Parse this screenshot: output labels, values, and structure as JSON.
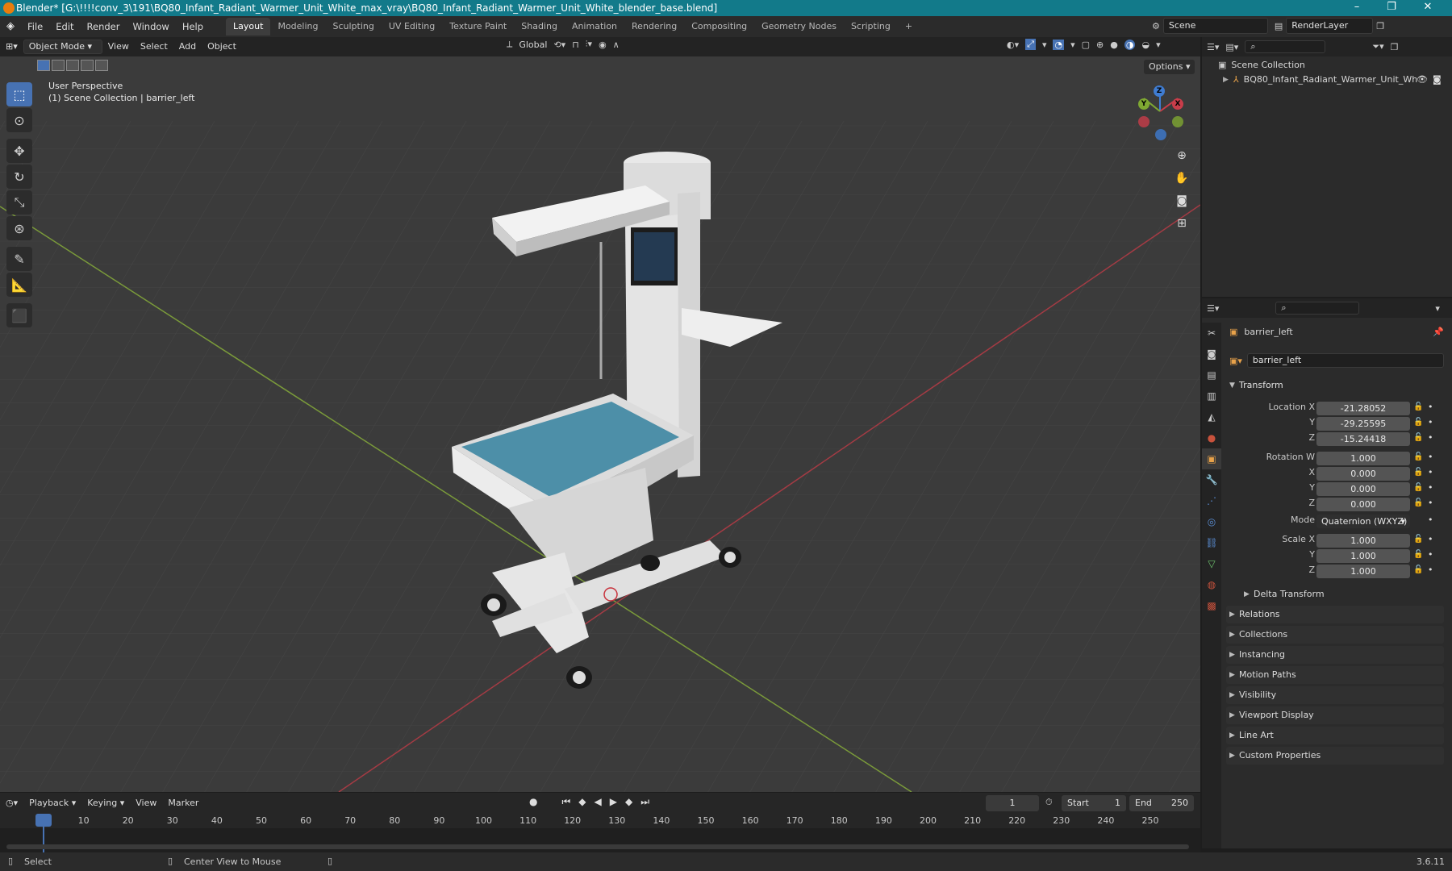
{
  "window": {
    "title": "Blender* [G:\\!!!!conv_3\\191\\BQ80_Infant_Radiant_Warmer_Unit_White_max_vray\\BQ80_Infant_Radiant_Warmer_Unit_White_blender_base.blend]",
    "controls": [
      "–",
      "❐",
      "✕"
    ]
  },
  "menus": [
    "File",
    "Edit",
    "Render",
    "Window",
    "Help"
  ],
  "workspaces": [
    "Layout",
    "Modeling",
    "Sculpting",
    "UV Editing",
    "Texture Paint",
    "Shading",
    "Animation",
    "Rendering",
    "Compositing",
    "Geometry Nodes",
    "Scripting"
  ],
  "active_workspace": "Layout",
  "scene": {
    "label": "Scene",
    "render_layer": "RenderLayer"
  },
  "viewport_header": {
    "mode": "Object Mode",
    "menus": [
      "View",
      "Select",
      "Add",
      "Object"
    ],
    "orientation": "Global",
    "options": "Options"
  },
  "viewport": {
    "perspective": "User Perspective",
    "collection_info": "(1) Scene Collection | barrier_left",
    "gizmo": {
      "x": "X",
      "y": "Y",
      "z": "Z"
    }
  },
  "outliner": {
    "root": "Scene Collection",
    "item": "BQ80_Infant_Radiant_Warmer_Unit_Wh"
  },
  "properties": {
    "object_name": "barrier_left",
    "data_name": "barrier_left",
    "transform_title": "Transform",
    "location": {
      "label": "Location X",
      "x": "-21.28052",
      "y": "-29.25595",
      "z": "-15.24418"
    },
    "rotation": {
      "label": "Rotation W",
      "w": "1.000",
      "x": "0.000",
      "y": "0.000",
      "z": "0.000"
    },
    "mode_label": "Mode",
    "mode_value": "Quaternion (WXYZ)",
    "scale": {
      "label": "Scale X",
      "x": "1.000",
      "y": "1.000",
      "z": "1.000"
    },
    "axis_labels": {
      "x": "X",
      "y": "Y",
      "z": "Z"
    },
    "delta": "Delta Transform",
    "panels": [
      "Relations",
      "Collections",
      "Instancing",
      "Motion Paths",
      "Visibility",
      "Viewport Display",
      "Line Art",
      "Custom Properties"
    ]
  },
  "timeline": {
    "menus": [
      "Playback",
      "Keying",
      "View",
      "Marker"
    ],
    "current_frame": "1",
    "start_label": "Start",
    "start": "1",
    "end_label": "End",
    "end": "250",
    "ticks": [
      "1",
      "10",
      "20",
      "30",
      "40",
      "50",
      "60",
      "70",
      "80",
      "90",
      "100",
      "110",
      "120",
      "130",
      "140",
      "150",
      "160",
      "170",
      "180",
      "190",
      "200",
      "210",
      "220",
      "230",
      "240",
      "250"
    ]
  },
  "status": {
    "select": "Select",
    "center": "Center View to Mouse",
    "version": "3.6.11"
  },
  "colors": {
    "accent": "#4772b3",
    "titlebar": "#127a8a",
    "x_axis": "#c93d4a",
    "y_axis": "#7fa832",
    "z_axis": "#3f7cd1"
  }
}
